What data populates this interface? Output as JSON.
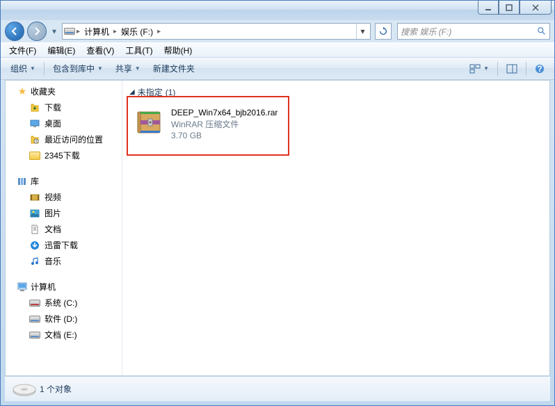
{
  "window_controls": {
    "min": "min",
    "max": "max",
    "close": "close"
  },
  "breadcrumb": {
    "items": [
      {
        "label": "计算机"
      },
      {
        "label": "娱乐 (F:)"
      }
    ]
  },
  "search": {
    "placeholder": "搜索 娱乐 (F:)"
  },
  "menubar": {
    "file": "文件(F)",
    "edit": "编辑(E)",
    "view": "查看(V)",
    "tools": "工具(T)",
    "help": "帮助(H)"
  },
  "toolbar": {
    "organize": "组织",
    "include": "包含到库中",
    "share": "共享",
    "newfolder": "新建文件夹"
  },
  "sidebar": {
    "favorites": {
      "label": "收藏夹",
      "items": [
        {
          "label": "下载",
          "icon": "download"
        },
        {
          "label": "桌面",
          "icon": "desktop"
        },
        {
          "label": "最近访问的位置",
          "icon": "recent"
        },
        {
          "label": "2345下载",
          "icon": "folder"
        }
      ]
    },
    "libraries": {
      "label": "库",
      "items": [
        {
          "label": "视频",
          "icon": "video"
        },
        {
          "label": "图片",
          "icon": "pictures"
        },
        {
          "label": "文档",
          "icon": "documents"
        },
        {
          "label": "迅雷下载",
          "icon": "xunlei"
        },
        {
          "label": "音乐",
          "icon": "music"
        }
      ]
    },
    "computer": {
      "label": "计算机",
      "items": [
        {
          "label": "系统 (C:)",
          "icon": "drive-sys"
        },
        {
          "label": "软件 (D:)",
          "icon": "drive"
        },
        {
          "label": "文档 (E:)",
          "icon": "drive"
        }
      ]
    }
  },
  "main": {
    "group": {
      "label": "未指定",
      "count": "(1)"
    },
    "files": [
      {
        "name": "DEEP_Win7x64_bjb2016.rar",
        "type": "WinRAR 压缩文件",
        "size": "3.70 GB"
      }
    ]
  },
  "status": {
    "text": "1 个对象"
  }
}
